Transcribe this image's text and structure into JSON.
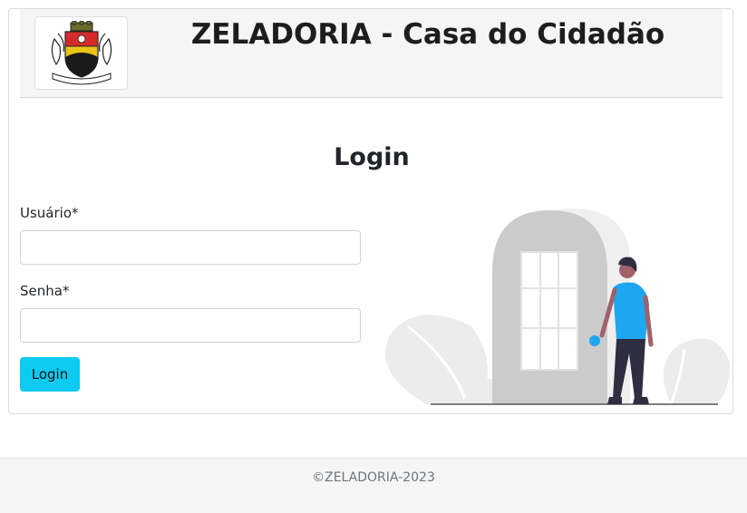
{
  "header": {
    "title": "ZELADORIA - Casa do Cidadão",
    "logo_icon": "municipal-coat-of-arms"
  },
  "login": {
    "title": "Login",
    "username_label": "Usuário*",
    "username_value": "",
    "password_label": "Senha*",
    "password_value": "",
    "submit_label": "Login"
  },
  "footer": {
    "text": "©ZELADORIA-2023"
  },
  "colors": {
    "button": "#0dcaf0",
    "header_bg": "#f5f5f5",
    "illustration_accent": "#1ea7f0"
  }
}
